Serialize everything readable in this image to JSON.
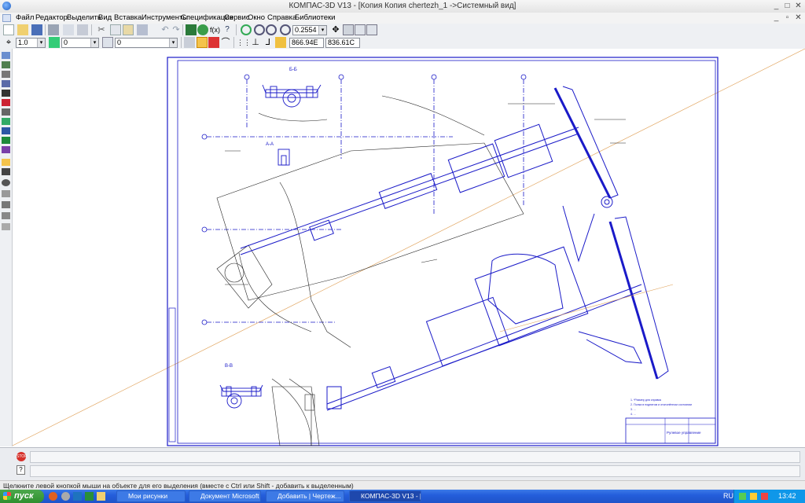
{
  "window": {
    "title": "КОМПАС-3D V13 - [Копия Копия chertezh_1  ->Системный вид]",
    "controls": [
      "_",
      "□",
      "✕"
    ]
  },
  "menu": [
    "Файл",
    "Редактор",
    "Выделить",
    "Вид",
    "Вставка",
    "Инструменты",
    "Спецификация",
    "Сервис",
    "Окно",
    "Справка",
    "Библиотеки"
  ],
  "toolbar": {
    "zoom_value": "0.2554",
    "line_scale": "1.0",
    "layer_value": "0",
    "style_value": "0",
    "coord_x": "866.94E",
    "coord_y": "836.61C"
  },
  "drawing": {
    "section_labels": [
      "Б-Б",
      "В-В",
      "А-А"
    ],
    "notes": [
      "1. *Размер для справок",
      "2. Полка в поднятом и отклонённом состоянии",
      "3. ...",
      "4. ..."
    ],
    "stamp_title": "Рулевое управление"
  },
  "status": {
    "hint": "Щелкните левой кнопкой мыши на объекте для его выделения (вместе с Ctrl или Shift - добавить к выделенным)"
  },
  "taskbar": {
    "start_label": "пуск",
    "tasks": [
      "Мои рисунки",
      "Документ Microsoft ...",
      "Добавить | Чертеж...",
      "КОМПАС-3D V13 - [К..."
    ],
    "language": "RU",
    "clock": "13:42"
  },
  "colors": {
    "drawing_blue": "#1a1ac8",
    "axis_orange": "#e0a25a",
    "taskbar_blue": "#245edb"
  }
}
